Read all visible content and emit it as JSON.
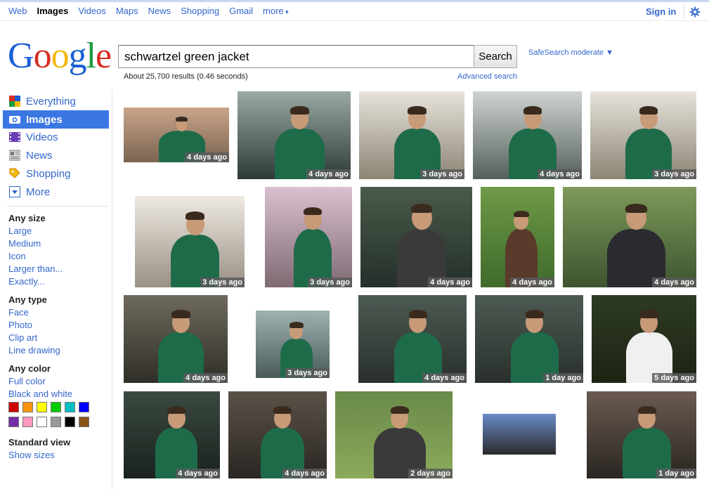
{
  "nav": {
    "items": [
      "Web",
      "Images",
      "Videos",
      "Maps",
      "News",
      "Shopping",
      "Gmail",
      "more"
    ],
    "active": "Images",
    "signin": "Sign in"
  },
  "logo": {
    "letters": [
      "G",
      "o",
      "o",
      "g",
      "l",
      "e"
    ]
  },
  "search": {
    "query": "schwartzel green jacket",
    "button": "Search",
    "safesearch": "SafeSearch moderate ▼",
    "stats": "About 25,700 results (0.46 seconds)",
    "advanced": "Advanced search"
  },
  "sidebar": {
    "items": [
      {
        "label": "Everything",
        "icon": "everything-icon"
      },
      {
        "label": "Images",
        "icon": "camera-icon",
        "active": true
      },
      {
        "label": "Videos",
        "icon": "film-icon"
      },
      {
        "label": "News",
        "icon": "newspaper-icon"
      },
      {
        "label": "Shopping",
        "icon": "tag-icon"
      },
      {
        "label": "More",
        "icon": "chevron-down-icon"
      }
    ],
    "size": {
      "heading": "Any size",
      "options": [
        "Large",
        "Medium",
        "Icon",
        "Larger than...",
        "Exactly..."
      ]
    },
    "type": {
      "heading": "Any type",
      "options": [
        "Face",
        "Photo",
        "Clip art",
        "Line drawing"
      ]
    },
    "color": {
      "heading": "Any color",
      "options": [
        "Full color",
        "Black and white"
      ],
      "swatches": [
        "#cc0000",
        "#fb940b",
        "#ffff00",
        "#00cc00",
        "#03c0c6",
        "#0000ff",
        "#762ca7",
        "#ff98bf",
        "#ffffff",
        "#999999",
        "#000000",
        "#885418"
      ]
    },
    "view": {
      "heading": "Standard view",
      "link": "Show sizes"
    }
  },
  "results": [
    {
      "age": "4 days ago"
    },
    {
      "age": "4 days ago"
    },
    {
      "age": "3 days ago"
    },
    {
      "age": "4 days ago"
    },
    {
      "age": "3 days ago"
    },
    {
      "age": "3 days ago"
    },
    {
      "age": "3 days ago"
    },
    {
      "age": "4 days ago"
    },
    {
      "age": "4 days ago"
    },
    {
      "age": "4 days ago"
    },
    {
      "age": "4 days ago"
    },
    {
      "age": "3 days ago"
    },
    {
      "age": "4 days ago"
    },
    {
      "age": "1 day ago"
    },
    {
      "age": "5 days ago"
    },
    {
      "age": "4 days ago"
    },
    {
      "age": "4 days ago"
    },
    {
      "age": "2 days ago"
    },
    {
      "age": ""
    },
    {
      "age": "1 day ago"
    }
  ]
}
